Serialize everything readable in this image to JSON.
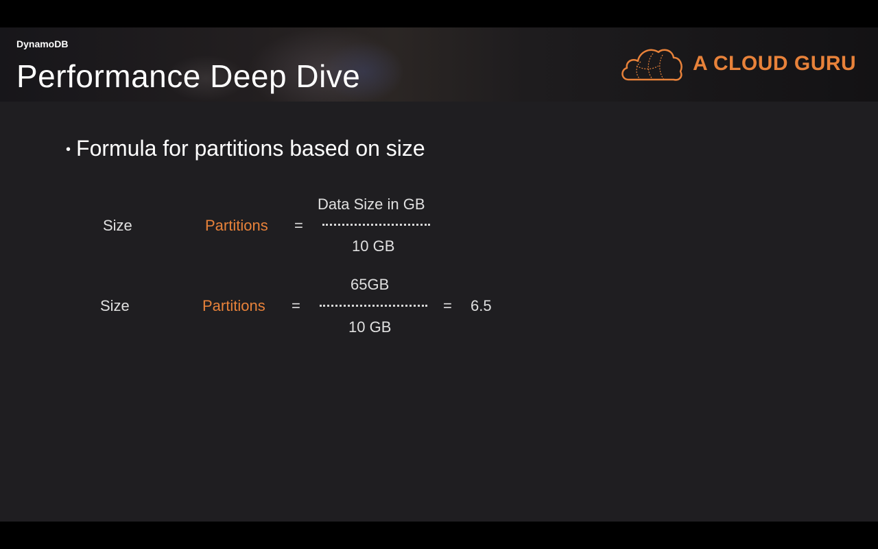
{
  "header": {
    "subtitle": "DynamoDB",
    "title": "Performance Deep Dive",
    "brand": "A CLOUD GURU"
  },
  "colors": {
    "accent": "#e8823a",
    "slide_bg": "#1f1e21"
  },
  "content": {
    "bullet": "Formula for partitions based on size",
    "formula1": {
      "label": "Size",
      "term": "Partitions",
      "equals": "=",
      "numerator": "Data Size in GB",
      "denominator": "10 GB"
    },
    "formula2": {
      "label": "Size",
      "term": "Partitions",
      "equals": "=",
      "numerator": "65GB",
      "denominator": "10 GB",
      "equals2": "=",
      "result": "6.5"
    }
  }
}
